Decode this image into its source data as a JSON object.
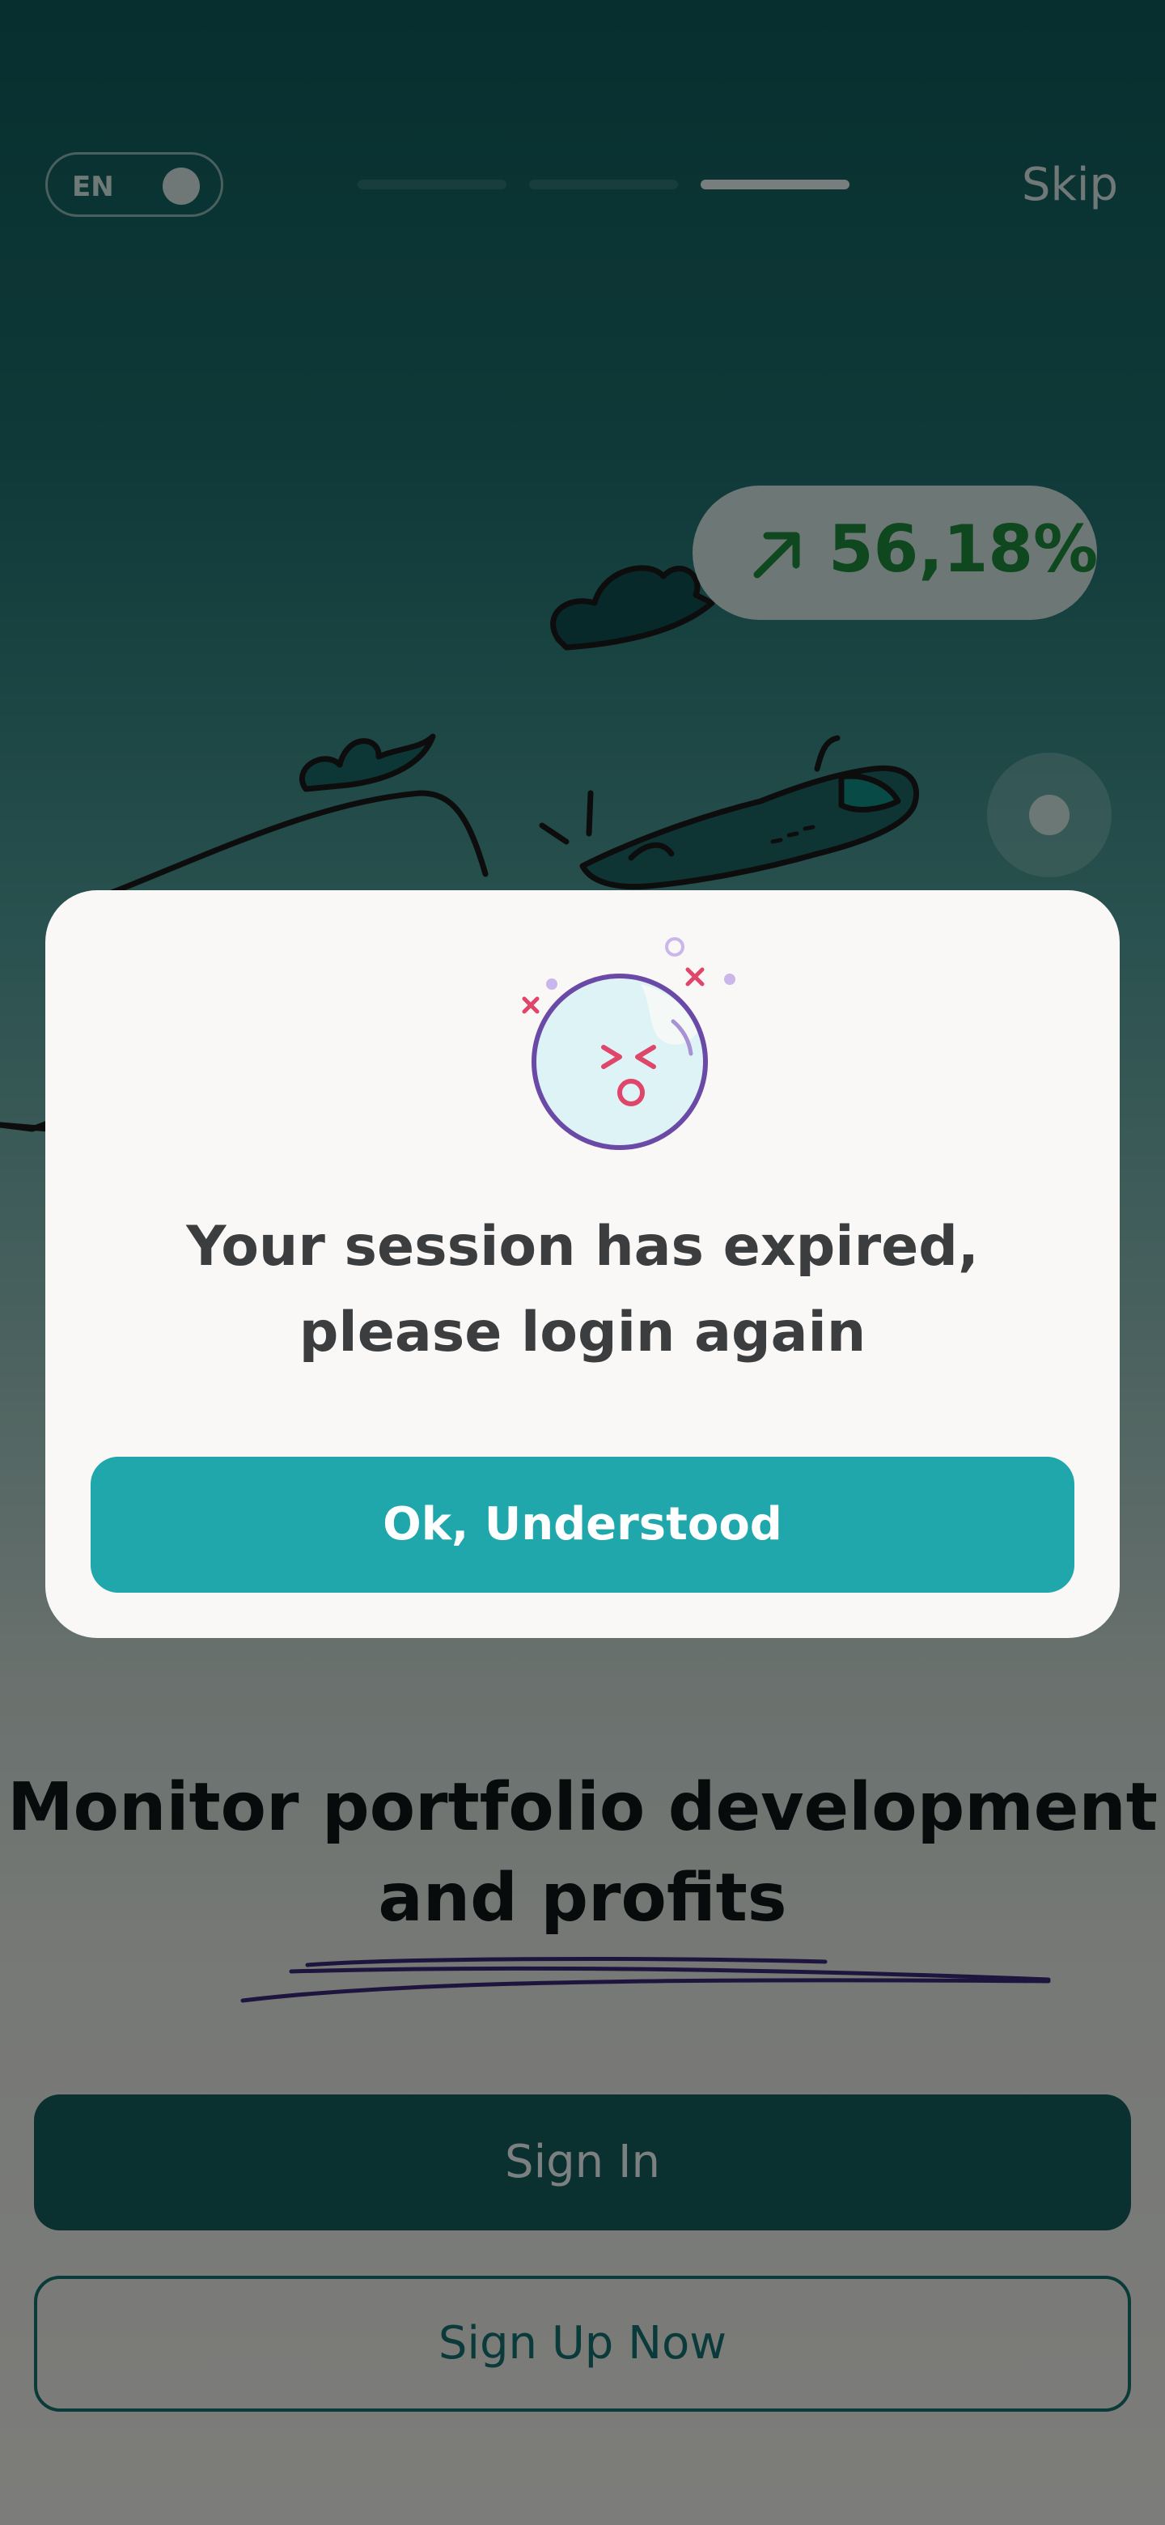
{
  "language_toggle": {
    "label": "EN"
  },
  "onboarding": {
    "active_step": 3,
    "total_steps": 3,
    "skip_label": "Skip"
  },
  "illustration": {
    "profit_badge": "56,18%"
  },
  "headline": "Monitor portfolio development and profits",
  "buttons": {
    "sign_in": "Sign In",
    "sign_up": "Sign Up Now"
  },
  "modal": {
    "message": "Your session has expired, please login again",
    "ok_label": "Ok, Understood"
  },
  "colors": {
    "primary_teal": "#155d5d",
    "modal_button": "#1fa7ab",
    "profit_green": "#1e8a3b",
    "accent_purple": "#6a4aa6",
    "accent_red": "#e0456a"
  }
}
